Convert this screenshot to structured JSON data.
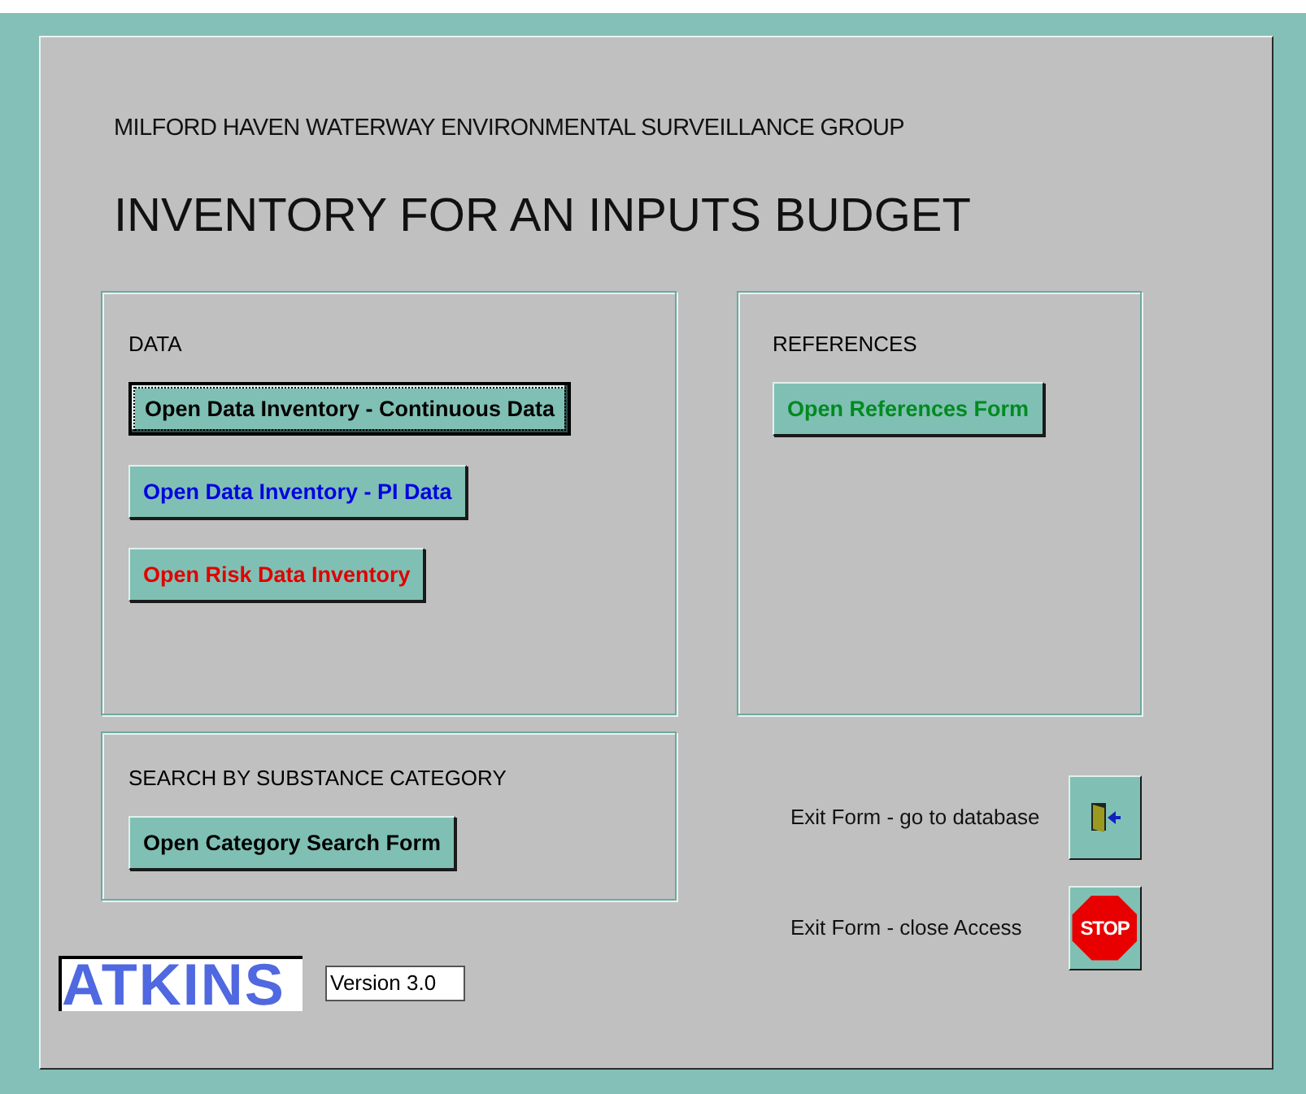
{
  "header": {
    "organisation": "MILFORD HAVEN WATERWAY ENVIRONMENTAL SURVEILLANCE GROUP",
    "title": "INVENTORY FOR AN INPUTS BUDGET"
  },
  "data_section": {
    "heading": "DATA",
    "buttons": [
      {
        "label": "Open Data Inventory - Continuous Data",
        "color": "#000000",
        "focused": true
      },
      {
        "label": "Open Data Inventory - PI Data",
        "color": "#0000e0",
        "focused": false
      },
      {
        "label": "Open Risk Data Inventory",
        "color": "#e00000",
        "focused": false
      }
    ]
  },
  "references_section": {
    "heading": "REFERENCES",
    "buttons": [
      {
        "label": "Open References Form",
        "color": "#008a20",
        "focused": false
      }
    ]
  },
  "search_section": {
    "heading": "SEARCH BY SUBSTANCE CATEGORY",
    "buttons": [
      {
        "label": "Open Category Search Form",
        "color": "#000000",
        "focused": false
      }
    ]
  },
  "exit_actions": [
    {
      "label": "Exit Form - go to database",
      "kind": "door"
    },
    {
      "label": "Exit Form - close Access",
      "kind": "stop",
      "icon_text": "STOP"
    }
  ],
  "footer": {
    "logo": "ATKINS",
    "version": "Version 3.0"
  }
}
